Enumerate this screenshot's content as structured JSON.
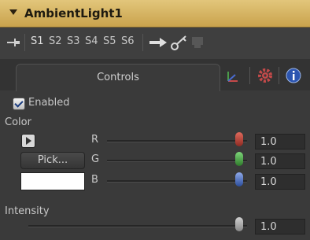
{
  "node": {
    "title": "AmbientLight1"
  },
  "toolbar": {
    "slots": [
      "S1",
      "S2",
      "S3",
      "S4",
      "S5",
      "S6"
    ]
  },
  "tabs": {
    "controls_label": "Controls"
  },
  "enabled": {
    "label": "Enabled",
    "checked": true
  },
  "color": {
    "section_label": "Color",
    "pick_label": "Pick...",
    "swatch": "#ffffff",
    "channels": [
      {
        "label": "R",
        "value": "1.0",
        "knob_color": "#b23a2f"
      },
      {
        "label": "G",
        "value": "1.0",
        "knob_color": "#3f8f3a"
      },
      {
        "label": "B",
        "value": "1.0",
        "knob_color": "#3a5fb0"
      }
    ]
  },
  "intensity": {
    "label": "Intensity",
    "value": "1.0"
  },
  "colors": {
    "titlebar": "#d8b765",
    "panel": "#3a3a3a"
  }
}
